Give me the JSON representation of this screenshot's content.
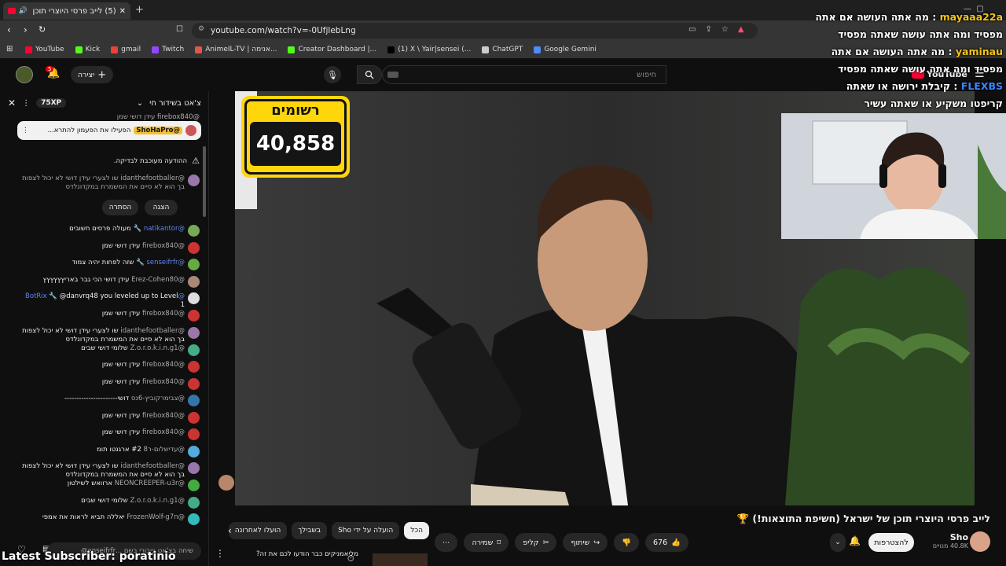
{
  "browser": {
    "tab_title": "(5) לייב פרסי היוצרי תוכן של",
    "new_tab": "+",
    "url": "youtube.com/watch?v=-0UfjlebLng",
    "bookmarks": [
      {
        "label": "YouTube",
        "color": "#ff0033"
      },
      {
        "label": "Kick",
        "color": "#53fc18"
      },
      {
        "label": "gmail",
        "color": "#ea4335"
      },
      {
        "label": "Twitch",
        "color": "#9146ff"
      },
      {
        "label": "AnimeIL-TV | אנימה...",
        "color": "#e0574f"
      },
      {
        "label": "Creator Dashboard |...",
        "color": "#53fc18"
      },
      {
        "label": "(1) X \\ Yair|sensei (...",
        "color": "#000000"
      },
      {
        "label": "ChatGPT",
        "color": "#cccccc"
      },
      {
        "label": "Google Gemini",
        "color": "#4e8cf7"
      }
    ]
  },
  "header": {
    "create_label": "יצירה",
    "notif_count": "5",
    "search_placeholder": "חיפוש",
    "logo_text": "YouTube"
  },
  "chat": {
    "title": "צ'אט בשידור חי",
    "xp": "75XP",
    "pinned_user": "@ShoHaPro",
    "pinned_text": "הפעילו את הפעמון להתרא...",
    "pinned_partial_user": "@firebox840",
    "pinned_partial_text": "עידן דושי שמן",
    "notice": "ההודעה מעוכבת לבדיקה.",
    "held_user": "@idanthefootballer",
    "held_text": "שו לצערי עידן דושי לא יכול לצפות בך הוא לא סיים את המשמרת במקדונלדס",
    "show_label": "הצגה",
    "hide_label": "הסתרה",
    "messages": [
      {
        "user": "@natikantor",
        "text": "מעולה פרסים חשובים",
        "mod": true,
        "color": "#7a5"
      },
      {
        "user": "@firebox840",
        "text": "עידן דושי שמן",
        "mod": false,
        "color": "#c33"
      },
      {
        "user": "@senseifrfr",
        "text": "שזה לפחות יהיה צמוד",
        "mod": true,
        "color": "#6a4"
      },
      {
        "user": "@Erez-Cohen80",
        "text": "עידן דושי הכי גבר באריץץץץץץ",
        "mod": false,
        "color": "#a87"
      },
      {
        "user": "@BotRix",
        "text": "@danvrq48 you leveled up to Level 1",
        "mod": true,
        "color": "#ddd"
      },
      {
        "user": "@firebox840",
        "text": "עידן דושי שמן",
        "mod": false,
        "color": "#c33"
      },
      {
        "user": "@idanthefootballer",
        "text": "שו לצערי עידן דושי לא יכול לצפות בך הוא לא סיים את המשמרת במקדונלדס",
        "mod": false,
        "color": "#97a"
      },
      {
        "user": "@Z.o.r.o.k.i.n.g1",
        "text": "שלומי דושי שבים",
        "mod": false,
        "color": "#4a8"
      },
      {
        "user": "@firebox840",
        "text": "עידן דושי שמן",
        "mod": false,
        "color": "#c33"
      },
      {
        "user": "@firebox840",
        "text": "עידן דושי שמן",
        "mod": false,
        "color": "#c33"
      },
      {
        "user": "@צבימרקוביץ-6נס",
        "text": "דושי----------------------",
        "mod": false,
        "color": "#37a"
      },
      {
        "user": "@firebox840",
        "text": "עידן דושי שמן",
        "mod": false,
        "color": "#c33"
      },
      {
        "user": "@firebox840",
        "text": "עידן דושי שמן",
        "mod": false,
        "color": "#c33"
      },
      {
        "user": "@עדישלום-ר8",
        "text": "#2 ארגנטו תומ",
        "mod": false,
        "color": "#5ad"
      },
      {
        "user": "@idanthefootballer",
        "text": "שו לצערי עידן דושי לא יכול לצפות בך הוא לא סיים את המשמרת במקדונלדס",
        "mod": false,
        "color": "#97a"
      },
      {
        "user": "@NEONCREEPER-u3r",
        "text": "ארוואש לשילטון",
        "mod": false,
        "color": "#4a4"
      },
      {
        "user": "@Z.o.r.o.k.i.n.g1",
        "text": "שלומי דושי שבים",
        "mod": false,
        "color": "#4a8"
      },
      {
        "user": "@FrozenWolf-g7n",
        "text": "יאללה תביא לראות את אמפי",
        "mod": false,
        "color": "#3bb"
      }
    ],
    "input_placeholder": "שיחה בצ'אט ציבורי בשם ...enseifrfr@"
  },
  "overlay": {
    "counter_label": "רשומים",
    "counter_value": "40,858",
    "latest_subscriber": "Latest Subscriber: poratinio",
    "chat_lines": [
      {
        "user": "mayaaa22a",
        "text": ": מה אתה העושה אם אתה"
      },
      {
        "user": "",
        "text": "מפסיד ומה אתה עושה שאתה מפסיד"
      },
      {
        "user": "yaminau",
        "text": ": מה אתה העושה אם אתה"
      },
      {
        "user": "",
        "text": "מפסיד ומה אתה עושה שאתה מפסיד"
      },
      {
        "user": "FLEXBS",
        "text": ": קיבלת ירושה או שאתה"
      },
      {
        "user": "",
        "text": "קריפטו משקיע או שאתה עשיר"
      }
    ]
  },
  "below_video": {
    "title": "לייב פרסי היוצרי תוכן של ישראל (חשיפת התוצאות!) 🏆",
    "filters": [
      "הכל",
      "הועלה על ידי Sho",
      "בשבילך",
      "הועלו לאחרונה"
    ],
    "likes": "676",
    "share_label": "שיתוף",
    "clip_label": "קליפ",
    "save_label": "שמירה",
    "subscribe_label": "להצטרפות",
    "channel_name": "Sho",
    "channel_subs": "40.8K מנויים",
    "related_text": "מליאמניקים כבר הודעו לכם את זה?"
  }
}
